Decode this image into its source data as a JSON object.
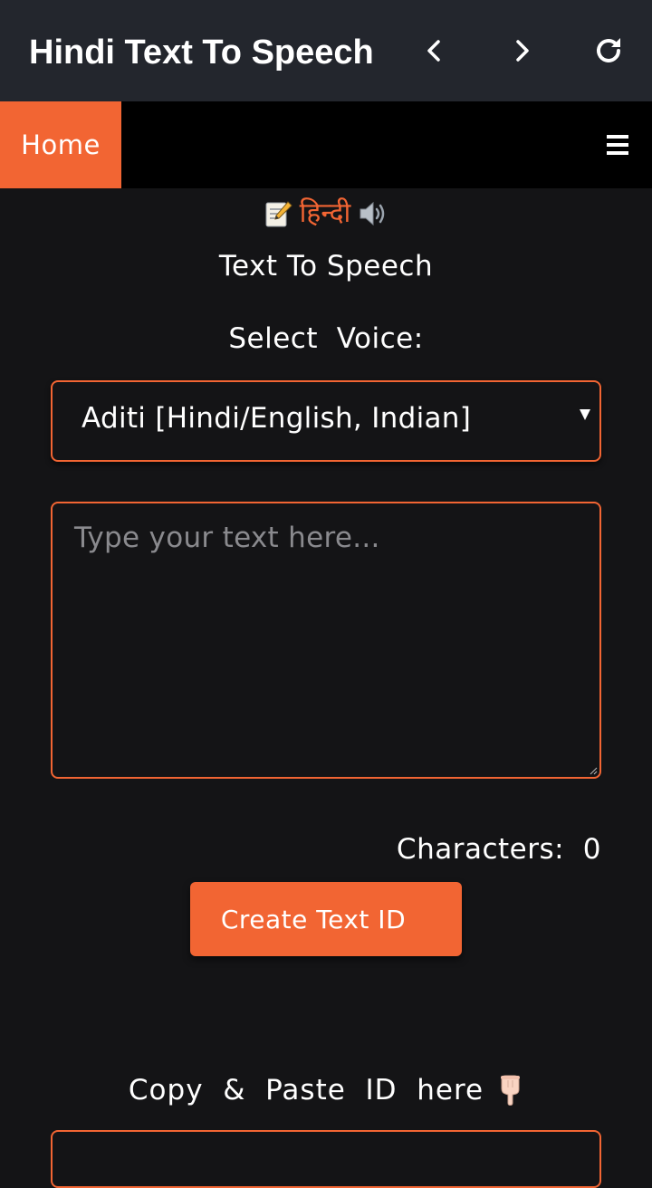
{
  "app_bar": {
    "title": "Hindi Text To Speech",
    "icons": [
      "chevron-left-icon",
      "chevron-right-icon",
      "refresh-icon"
    ]
  },
  "nav": {
    "home_label": "Home",
    "menu_icon": "hamburger-icon"
  },
  "brand": {
    "hindi_word": "हिन्दी",
    "left_icon": "memo-icon",
    "right_icon": "speaker-icon"
  },
  "main": {
    "heading": "Text To Speech",
    "select_label": "Select  Voice:",
    "voice_selected": "Aditi [Hindi/English, Indian]",
    "textarea_placeholder": "Type your text here...",
    "characters_label": "Characters:  0",
    "create_button": "Create Text ID",
    "copy_label": "Copy  &  Paste  ID  here",
    "copy_icon": "pointing-down-hand-icon"
  },
  "colors": {
    "accent": "#f26533",
    "app_bar_bg": "#23262d",
    "nav_bg": "#000000",
    "page_bg": "#141416"
  }
}
